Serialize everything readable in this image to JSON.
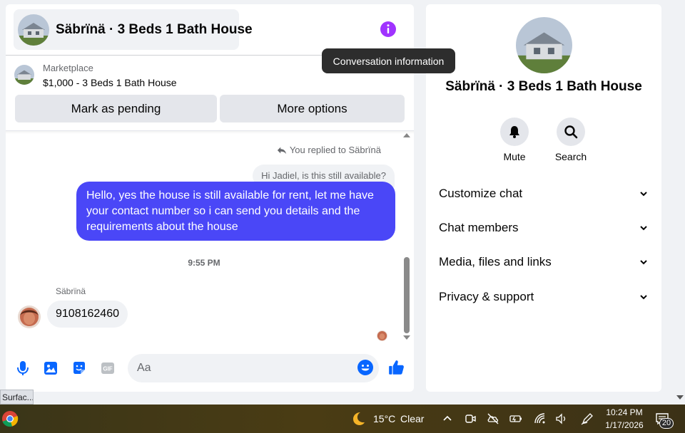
{
  "conversation": {
    "title": "Säbrïnä · 3 Beds 1 Bath House"
  },
  "marketplace": {
    "label": "Marketplace",
    "listing": "$1,000 - 3 Beds 1 Bath House"
  },
  "actions": {
    "mark_pending": "Mark as pending",
    "more_options": "More options"
  },
  "tooltip": "Conversation information",
  "messages": {
    "replied_to": "You replied to Säbrïnä",
    "quoted": "Hi Jadiel, is this still available?",
    "outgoing": "Hello, yes the house is still available for rent, let me have your contact number so i can send you details and the requirements about the house",
    "time_separator": "9:55 PM",
    "sender_name": "Säbrïnä",
    "incoming": "9108162460"
  },
  "composer": {
    "placeholder": "Aa"
  },
  "info_panel": {
    "title": "Säbrïnä · 3 Beds 1 Bath House",
    "mute_label": "Mute",
    "search_label": "Search",
    "sections": [
      "Customize chat",
      "Chat members",
      "Media, files and links",
      "Privacy & support"
    ]
  },
  "status_chip": "Surfac...",
  "taskbar": {
    "temperature": "15°C",
    "condition": "Clear",
    "time": "10:24 PM",
    "date": "1/17/2026",
    "notification_count": "20"
  },
  "colors": {
    "accent": "#0866ff",
    "outgoing_bubble": "#4a47f7",
    "info_icon": "#a033ff",
    "panel_bg": "#f0f2f5"
  },
  "icons": [
    "info-icon",
    "reply-icon",
    "microphone-icon",
    "photo-icon",
    "sticker-icon",
    "gif-icon",
    "emoji-icon",
    "thumbs-up-icon",
    "bell-icon",
    "search-icon",
    "chevron-down-icon",
    "moon-icon",
    "chrome-icon",
    "notification-icon"
  ]
}
